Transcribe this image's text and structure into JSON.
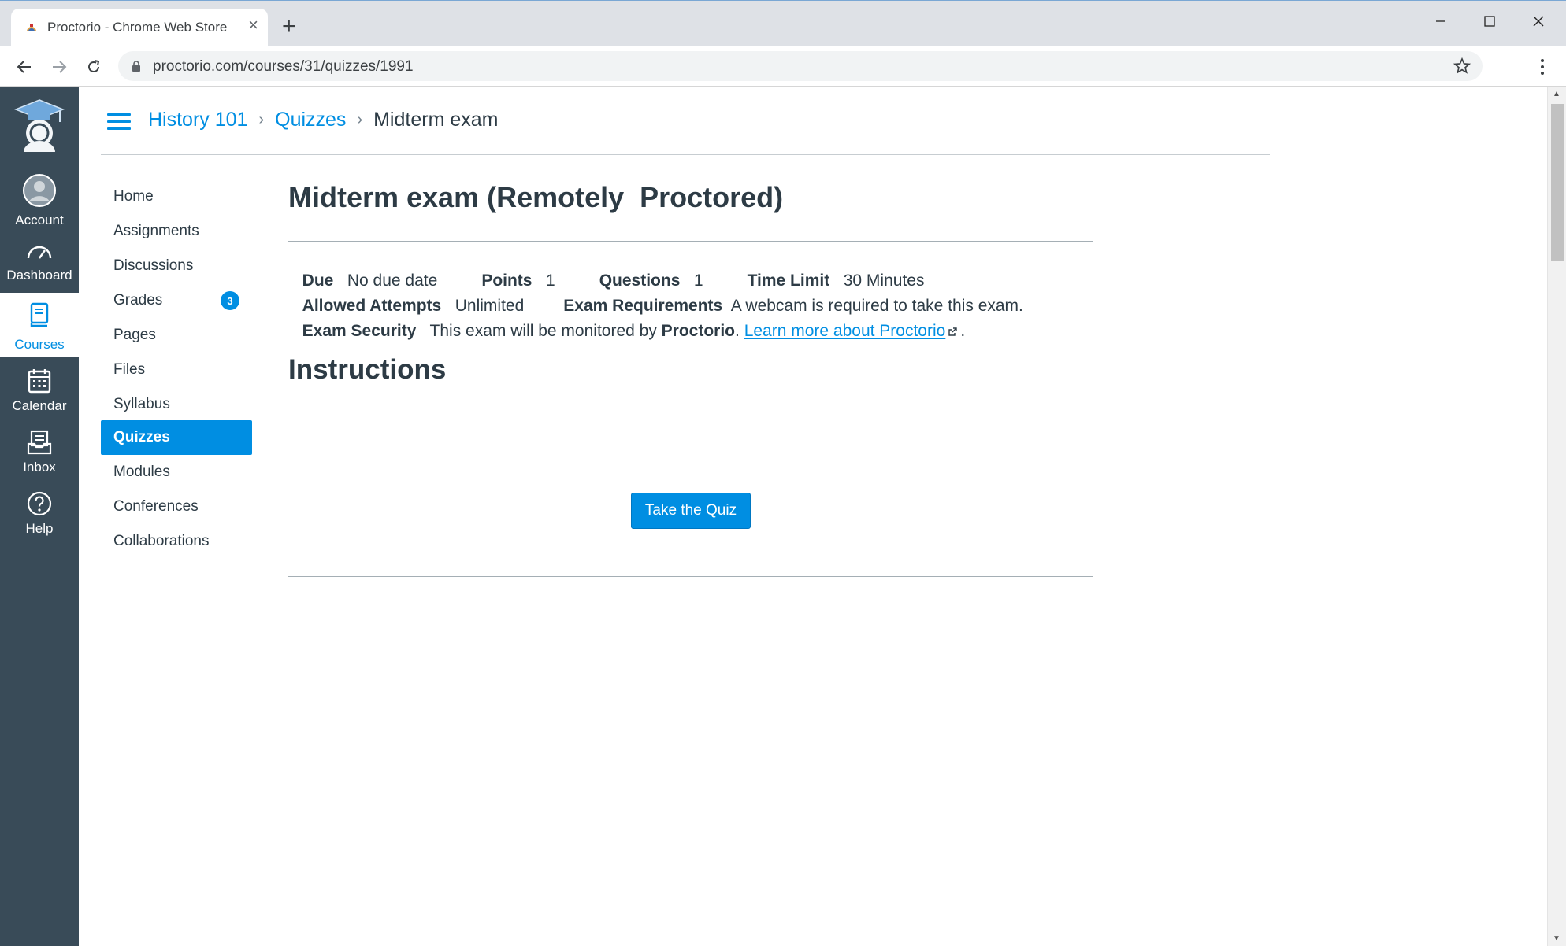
{
  "browser": {
    "tab_title": "Proctorio - Chrome Web Store",
    "tab_close": "×",
    "new_tab": "+",
    "url": "proctorio.com/courses/31/quizzes/1991"
  },
  "global_nav": {
    "items": [
      {
        "label": "Account",
        "icon": "account-icon"
      },
      {
        "label": "Dashboard",
        "icon": "dashboard-icon"
      },
      {
        "label": "Courses",
        "icon": "courses-icon",
        "active": true
      },
      {
        "label": "Calendar",
        "icon": "calendar-icon"
      },
      {
        "label": "Inbox",
        "icon": "inbox-icon"
      },
      {
        "label": "Help",
        "icon": "help-icon"
      }
    ]
  },
  "breadcrumb": {
    "course": "History 101",
    "section": "Quizzes",
    "current": "Midterm exam",
    "separator": "›"
  },
  "course_nav": {
    "items": [
      {
        "label": "Home"
      },
      {
        "label": "Assignments"
      },
      {
        "label": "Discussions"
      },
      {
        "label": "Grades",
        "badge": "3"
      },
      {
        "label": "Pages"
      },
      {
        "label": "Files"
      },
      {
        "label": "Syllabus"
      },
      {
        "label": "Quizzes",
        "active": true
      },
      {
        "label": "Modules"
      },
      {
        "label": "Conferences"
      },
      {
        "label": "Collaborations"
      }
    ]
  },
  "quiz": {
    "title": "Midterm exam (Remotely  Proctored)",
    "due_label": "Due",
    "due_value": "No due date",
    "points_label": "Points",
    "points_value": "1",
    "questions_label": "Questions",
    "questions_value": "1",
    "time_limit_label": "Time Limit",
    "time_limit_value": "30 Minutes",
    "attempts_label": "Allowed Attempts",
    "attempts_value": "Unlimited",
    "requirements_label": "Exam Requirements",
    "requirements_value": "A webcam is required to take this exam.",
    "security_label": "Exam Security",
    "security_text": "This exam will be monitored by",
    "security_brand": "Proctorio",
    "security_link": "Learn more about Proctorio",
    "instructions_heading": "Instructions",
    "take_button": "Take the Quiz"
  },
  "colors": {
    "accent": "#008ee2",
    "global_nav_bg": "#394b58",
    "text": "#2d3b45"
  }
}
